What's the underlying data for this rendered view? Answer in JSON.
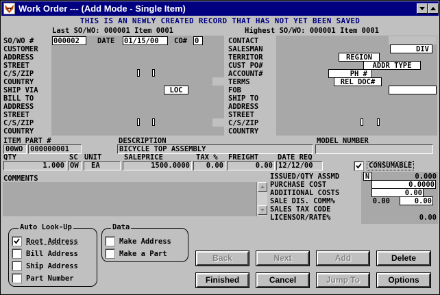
{
  "window": {
    "title": "Work Order --- (Add Mode - Single Item)",
    "icon": "fox-logo-icon"
  },
  "banner": "THIS IS AN NEWLY CREATED RECORD THAT HAS NOT YET BEEN SAVED",
  "header": {
    "last_so": "Last SO/WO: 000001 Item 0001",
    "highest_so": "Highest SO/WO: 000001 Item 0001"
  },
  "left_labels": {
    "so_wo": "SO/WO #",
    "customer": "CUSTOMER",
    "address": "ADDRESS",
    "street": "STREET",
    "cszip": "C/S/ZIP",
    "country": "COUNTRY",
    "ship_via": "SHIP VIA",
    "bill_to": "BILL TO",
    "address2": "ADDRESS",
    "street2": "STREET",
    "cszip2": "C/S/ZIP",
    "country2": "COUNTRY"
  },
  "left_panel": {
    "so_number": "000002",
    "date_label": "DATE",
    "date_value": "01/15/00",
    "co_label": "CO#",
    "co_value": "0",
    "loc_label": "LOC"
  },
  "right_labels": {
    "contact": "CONTACT",
    "salesman": "SALESMAN",
    "territor": "TERRITOR",
    "cust_po": "CUST PO#",
    "account": "ACCOUNT#",
    "terms": "TERMS",
    "fob": "FOB",
    "ship_to": "SHIP TO",
    "address": "ADDRESS",
    "street": "STREET",
    "cszip": "C/S/ZIP",
    "country": "COUNTRY"
  },
  "right_panel": {
    "div_label": "DIV",
    "region_label": "REGION",
    "addr_type_label": "ADDR TYPE",
    "ph_label": "PH #",
    "rel_doc_label": "REL DOC#"
  },
  "item": {
    "item_part_label": "ITEM PART #",
    "description_label": "DESCRIPTION",
    "model_number_label": "MODEL NUMBER",
    "item_prefix": "00WO",
    "item_number": "000000001",
    "description": "BICYCLE TOP ASSEMBLY",
    "model_number": ""
  },
  "pricing": {
    "qty_label": "QTY",
    "sc_label": "SC",
    "unit_label": "UNIT",
    "saleprice_label": "SALEPRICE",
    "tax_label": "TAX %",
    "freight_label": "FREIGHT",
    "date_req_label": "DATE REQ",
    "qty": "1.000",
    "sc": "OW",
    "unit": "EA",
    "saleprice": "1500.0000",
    "tax": "0.00",
    "freight": "0.00",
    "date_req": "12/12/00",
    "consumable_label": "CONSUMABLE",
    "consumable_checked": true
  },
  "comments": {
    "label": "COMMENTS",
    "text": ""
  },
  "costs": {
    "issued_label": "ISSUED/QTY ASSMD",
    "issued_flag": "N",
    "issued_value": "0.000",
    "purchase_label": "PURCHASE COST",
    "purchase_value": "0.0000",
    "additional_label": "ADDITIONAL COSTS",
    "additional_value": "0.00",
    "sale_dis_label": "SALE DIS. COMM%",
    "sale_dis_value": "0.00",
    "comm_value": "0.00",
    "sales_tax_label": "SALES TAX CODE",
    "licensor_label": "LICENSOR/RATE%",
    "licensor_value": "0.00"
  },
  "auto_lookup": {
    "title": "Auto Look-Up",
    "options": [
      {
        "label": "Root Address",
        "checked": true
      },
      {
        "label": "Bill Address",
        "checked": false
      },
      {
        "label": "Ship Address",
        "checked": false
      },
      {
        "label": "Part Number",
        "checked": false
      }
    ]
  },
  "data_group": {
    "title": "Data",
    "options": [
      {
        "label": "Make Address",
        "checked": false
      },
      {
        "label": "Make a Part",
        "checked": false
      }
    ]
  },
  "buttons": {
    "back": "Back",
    "next": "Next",
    "add": "Add",
    "delete": "Delete",
    "finished": "Finished",
    "cancel": "Cancel",
    "jump_to": "Jump To",
    "options": "Options"
  }
}
